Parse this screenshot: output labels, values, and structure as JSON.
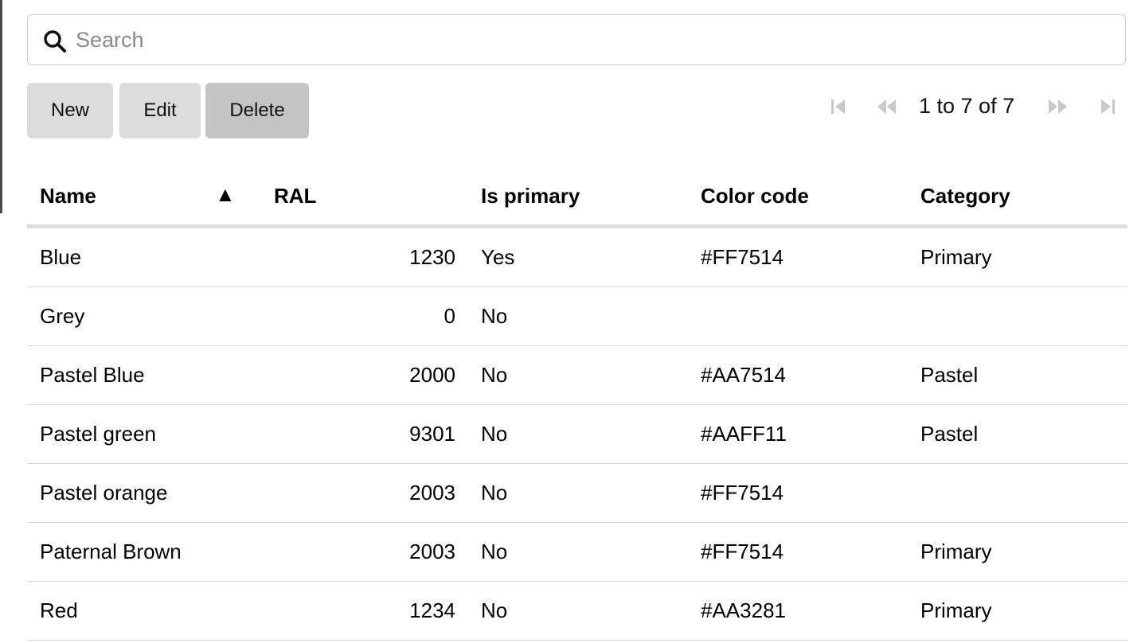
{
  "search": {
    "placeholder": "Search",
    "value": ""
  },
  "toolbar": {
    "new_label": "New",
    "edit_label": "Edit",
    "delete_label": "Delete"
  },
  "pagination": {
    "text": "1 to 7 of 7",
    "icons": [
      "first-page-icon",
      "previous-page-icon",
      "next-page-icon",
      "last-page-icon"
    ]
  },
  "table": {
    "sort_indicator": "▲",
    "columns": [
      "Name",
      "RAL",
      "Is primary",
      "Color code",
      "Category"
    ],
    "rows": [
      [
        "Blue",
        "1230",
        "Yes",
        "#FF7514",
        "Primary"
      ],
      [
        "Grey",
        "0",
        "No",
        "",
        ""
      ],
      [
        "Pastel Blue",
        "2000",
        "No",
        "#AA7514",
        "Pastel"
      ],
      [
        "Pastel green",
        "9301",
        "No",
        "#AAFF11",
        "Pastel"
      ],
      [
        "Pastel orange",
        "2003",
        "No",
        "#FF7514",
        ""
      ],
      [
        "Paternal Brown",
        "2003",
        "No",
        "#FF7514",
        "Primary"
      ],
      [
        "Red",
        "1234",
        "No",
        "#AA3281",
        "Primary"
      ]
    ]
  },
  "colors": {
    "button_bg": "#dcdcdc",
    "button_active_bg": "#c4c4c4",
    "pager_icon_disabled": "#c8c8c8",
    "row_divider": "#d6d6d6",
    "header_divider": "#dedede"
  }
}
